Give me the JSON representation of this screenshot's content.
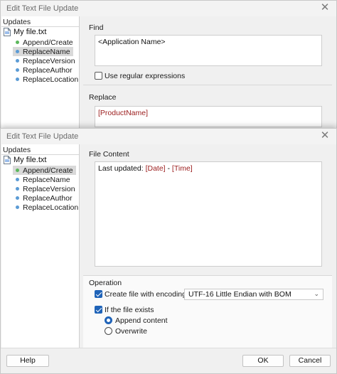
{
  "dialog_back": {
    "title": "Edit Text File Update",
    "tree": {
      "header": "Updates",
      "root": "My file.txt",
      "items": [
        {
          "label": "Append/Create",
          "color": "#5cb85c"
        },
        {
          "label": "ReplaceName",
          "color": "#5b9bd5",
          "selected": true
        },
        {
          "label": "ReplaceVersion",
          "color": "#5b9bd5"
        },
        {
          "label": "ReplaceAuthor",
          "color": "#5b9bd5"
        },
        {
          "label": "ReplaceLocation",
          "color": "#5b9bd5"
        }
      ]
    },
    "find": {
      "label": "Find",
      "value": "<Application Name>",
      "regex_label": "Use regular expressions",
      "regex_checked": false
    },
    "replace": {
      "label": "Replace",
      "value": "[ProductName]"
    }
  },
  "dialog_front": {
    "title": "Edit Text File Update",
    "tree": {
      "header": "Updates",
      "root": "My file.txt",
      "items": [
        {
          "label": "Append/Create",
          "color": "#5cb85c",
          "selected": true
        },
        {
          "label": "ReplaceName",
          "color": "#5b9bd5"
        },
        {
          "label": "ReplaceVersion",
          "color": "#5b9bd5"
        },
        {
          "label": "ReplaceAuthor",
          "color": "#5b9bd5"
        },
        {
          "label": "ReplaceLocation",
          "color": "#5b9bd5"
        }
      ]
    },
    "file_content": {
      "label": "File Content",
      "prefix": "Last updated: ",
      "token1": "[Date]",
      "sep": " - ",
      "token2": "[Time]"
    },
    "operation": {
      "label": "Operation",
      "create_label": "Create file with encoding:",
      "create_checked": true,
      "encoding": "UTF-16 Little Endian with BOM",
      "exists_label": "If the file exists",
      "exists_checked": true,
      "append_label": "Append content",
      "append_selected": true,
      "overwrite_label": "Overwrite",
      "overwrite_selected": false
    },
    "buttons": {
      "help": "Help",
      "ok": "OK",
      "cancel": "Cancel"
    }
  },
  "colors": {
    "token": "#9b1c1c",
    "accent": "#1f63b8"
  }
}
